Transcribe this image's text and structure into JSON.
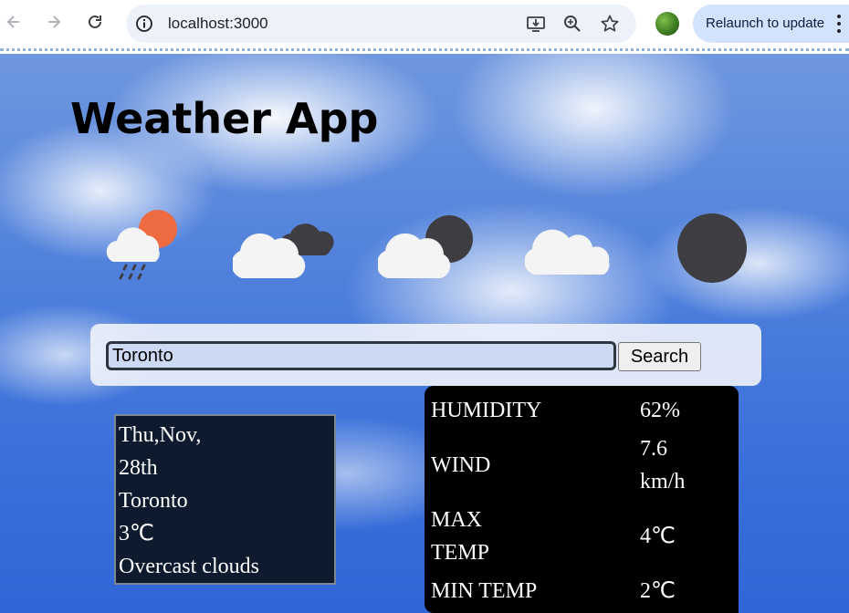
{
  "browser": {
    "url": "localhost:3000",
    "relaunch_label": "Relaunch to update",
    "icons": [
      "back-icon",
      "forward-icon",
      "reload-icon",
      "info-icon",
      "install-icon",
      "zoom-icon",
      "bookmark-star-icon",
      "profile-avatar",
      "more-menu-icon"
    ]
  },
  "app": {
    "title": "Weather App",
    "weather_icons": [
      "rain-cloud-sun-icon",
      "cloud-dark-cloud-icon",
      "cloud-moon-icon",
      "cloud-icon",
      "dark-circle-icon"
    ]
  },
  "search": {
    "value": "Toronto",
    "button_label": "Search"
  },
  "current": {
    "date_line1": "Thu,Nov,",
    "date_line2": "28th",
    "city": "Toronto",
    "temp": "3℃",
    "description": "Overcast clouds"
  },
  "details": {
    "humidity_label": "HUMIDITY",
    "humidity_value": "62%",
    "wind_label": "WIND",
    "wind_value_line1": "7.6",
    "wind_value_line2": "km/h",
    "max_label_line1": "MAX",
    "max_label_line2": "TEMP",
    "max_value": "4℃",
    "min_label": "MIN TEMP",
    "min_value": "2℃"
  },
  "colors": {
    "sun_orange": "#ee6a40",
    "cloud_white": "#f4f4f4",
    "cloud_dark": "#3e3e42",
    "omnibox_bg": "#edf2fa",
    "relaunch_bg": "#d3e3fd"
  }
}
